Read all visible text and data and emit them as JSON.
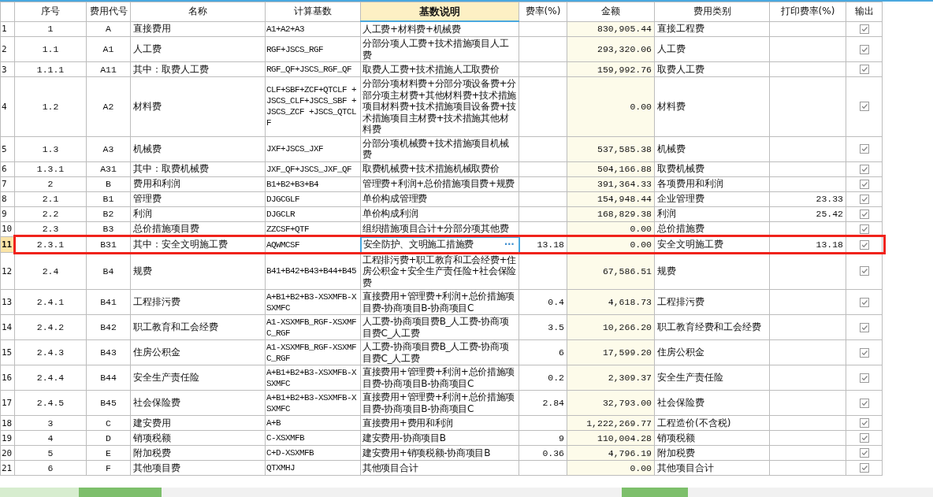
{
  "table": {
    "columns": [
      "序号",
      "费用代号",
      "名称",
      "计算基数",
      "基数说明",
      "费率(%)",
      "金额",
      "费用类别",
      "打印费率(%)",
      "输出"
    ],
    "rows": [
      {
        "no": "1",
        "seq": "1",
        "code": "A",
        "name": "直接费用",
        "base": "A1+A2+A3",
        "desc": "人工费+材料费+机械费",
        "amount": "830,905.44",
        "category": "直接工程费",
        "output": true,
        "selected": false,
        "boxed": false
      },
      {
        "no": "2",
        "seq": "1.1",
        "code": "A1",
        "name": "人工费",
        "base": "RGF+JSCS_RGF",
        "desc": "分部分项人工费+技术措施项目人工费",
        "amount": "293,320.06",
        "category": "人工费",
        "output": true,
        "selected": false,
        "boxed": false
      },
      {
        "no": "3",
        "seq": "1.1.1",
        "code": "A11",
        "name": "其中：取费人工费",
        "base": "RGF_QF+JSCS_RGF_QF",
        "desc": "取费人工费+技术措施人工取费价",
        "amount": "159,992.76",
        "category": "取费人工费",
        "output": true,
        "selected": false,
        "boxed": false
      },
      {
        "no": "4",
        "seq": "1.2",
        "code": "A2",
        "name": "材料费",
        "base": "CLF+SBF+ZCF+QTCLF +JSCS_CLF+JSCS_SBF +JSCS_ZCF +JSCS_QTCLF",
        "desc": "分部分项材料费+分部分项设备费+分部分项主材费+其他材料费+技术措施项目材料费+技术措施项目设备费+技术措施项目主材费+技术措施其他材料费",
        "amount": "0.00",
        "category": "材料费",
        "output": true,
        "selected": false,
        "boxed": false
      },
      {
        "no": "5",
        "seq": "1.3",
        "code": "A3",
        "name": "机械费",
        "base": "JXF+JSCS_JXF",
        "desc": "分部分项机械费+技术措施项目机械费",
        "amount": "537,585.38",
        "category": "机械费",
        "output": true,
        "selected": false,
        "boxed": false
      },
      {
        "no": "6",
        "seq": "1.3.1",
        "code": "A31",
        "name": "其中：取费机械费",
        "base": "JXF_QF+JSCS_JXF_QF",
        "desc": "取费机械费+技术措施机械取费价",
        "amount": "504,166.88",
        "category": "取费机械费",
        "output": true,
        "selected": false,
        "boxed": false
      },
      {
        "no": "7",
        "seq": "2",
        "code": "B",
        "name": "费用和利润",
        "base": "B1+B2+B3+B4",
        "desc": "管理费+利润+总价措施项目费+规费",
        "amount": "391,364.33",
        "category": "各项费用和利润",
        "output": true,
        "selected": false,
        "boxed": false
      },
      {
        "no": "8",
        "seq": "2.1",
        "code": "B1",
        "name": "管理费",
        "base": "DJGCGLF",
        "desc": "单价构成管理费",
        "amount": "154,948.44",
        "category": "企业管理费",
        "print_rate": "23.33",
        "output": true,
        "selected": false,
        "boxed": false
      },
      {
        "no": "9",
        "seq": "2.2",
        "code": "B2",
        "name": "利润",
        "base": "DJGCLR",
        "desc": "单价构成利润",
        "amount": "168,829.38",
        "category": "利润",
        "print_rate": "25.42",
        "output": true,
        "selected": false,
        "boxed": false
      },
      {
        "no": "10",
        "seq": "2.3",
        "code": "B3",
        "name": "总价措施项目费",
        "base": "ZZCSF+QTF",
        "desc": "组织措施项目合计+分部分项其他费",
        "amount": "0.00",
        "category": "总价措施费",
        "output": true,
        "selected": false,
        "boxed": false
      },
      {
        "no": "11",
        "seq": "2.3.1",
        "code": "B31",
        "name": "其中：安全文明施工费",
        "base": "AQWMCSF",
        "desc": "安全防护、文明施工措施费",
        "edit_button": "···",
        "rate": "13.18",
        "amount": "0.00",
        "category": "安全文明施工费",
        "print_rate": "13.18",
        "output": true,
        "selected": true,
        "boxed": true
      },
      {
        "no": "12",
        "seq": "2.4",
        "code": "B4",
        "name": "规费",
        "base": "B41+B42+B43+B44+B45",
        "desc": "工程排污费+职工教育和工会经费+住房公积金+安全生产责任险+社会保险费",
        "amount": "67,586.51",
        "category": "规费",
        "output": true,
        "selected": false,
        "boxed": false
      },
      {
        "no": "13",
        "seq": "2.4.1",
        "code": "B41",
        "name": "工程排污费",
        "base": "A+B1+B2+B3-XSXMFB-XSXMFC",
        "desc": "直接费用+管理费+利润+总价措施项目费-协商项目B-协商项目C",
        "rate": "0.4",
        "amount": "4,618.73",
        "category": "工程排污费",
        "output": true,
        "selected": false,
        "boxed": false
      },
      {
        "no": "14",
        "seq": "2.4.2",
        "code": "B42",
        "name": "职工教育和工会经费",
        "base": "A1-XSXMFB_RGF-XSXMFC_RGF",
        "desc": "人工费-协商项目费B_人工费-协商项目费C_人工费",
        "rate": "3.5",
        "amount": "10,266.20",
        "category": "职工教育经费和工会经费",
        "output": true,
        "selected": false,
        "boxed": false
      },
      {
        "no": "15",
        "seq": "2.4.3",
        "code": "B43",
        "name": "住房公积金",
        "base": "A1-XSXMFB_RGF-XSXMFC_RGF",
        "desc": "人工费-协商项目费B_人工费-协商项目费C_人工费",
        "rate": "6",
        "amount": "17,599.20",
        "category": "住房公积金",
        "output": true,
        "selected": false,
        "boxed": false
      },
      {
        "no": "16",
        "seq": "2.4.4",
        "code": "B44",
        "name": "安全生产责任险",
        "base": "A+B1+B2+B3-XSXMFB-XSXMFC",
        "desc": "直接费用+管理费+利润+总价措施项目费-协商项目B-协商项目C",
        "rate": "0.2",
        "amount": "2,309.37",
        "category": "安全生产责任险",
        "output": true,
        "selected": false,
        "boxed": false
      },
      {
        "no": "17",
        "seq": "2.4.5",
        "code": "B45",
        "name": "社会保险费",
        "base": "A+B1+B2+B3-XSXMFB-XSXMFC",
        "desc": "直接费用+管理费+利润+总价措施项目费-协商项目B-协商项目C",
        "rate": "2.84",
        "amount": "32,793.00",
        "category": "社会保险费",
        "output": true,
        "selected": false,
        "boxed": false
      },
      {
        "no": "18",
        "seq": "3",
        "code": "C",
        "name": "建安费用",
        "base": "A+B",
        "desc": "直接费用+费用和利润",
        "amount": "1,222,269.77",
        "category": "工程造价(不含税)",
        "output": true,
        "selected": false,
        "boxed": false
      },
      {
        "no": "19",
        "seq": "4",
        "code": "D",
        "name": "销项税额",
        "base": "C-XSXMFB",
        "desc": "建安费用-协商项目B",
        "rate": "9",
        "amount": "110,004.28",
        "category": "销项税额",
        "output": true,
        "selected": false,
        "boxed": false
      },
      {
        "no": "20",
        "seq": "5",
        "code": "E",
        "name": "附加税费",
        "base": "C+D-XSXMFB",
        "desc": "建安费用+销项税额-协商项目B",
        "rate": "0.36",
        "amount": "4,796.19",
        "category": "附加税费",
        "output": true,
        "selected": false,
        "boxed": false
      },
      {
        "no": "21",
        "seq": "6",
        "code": "F",
        "name": "其他项目费",
        "base": "QTXMHJ",
        "desc": "其他项目合计",
        "amount": "0.00",
        "category": "其他项目合计",
        "output": true,
        "selected": false,
        "boxed": false
      }
    ]
  }
}
